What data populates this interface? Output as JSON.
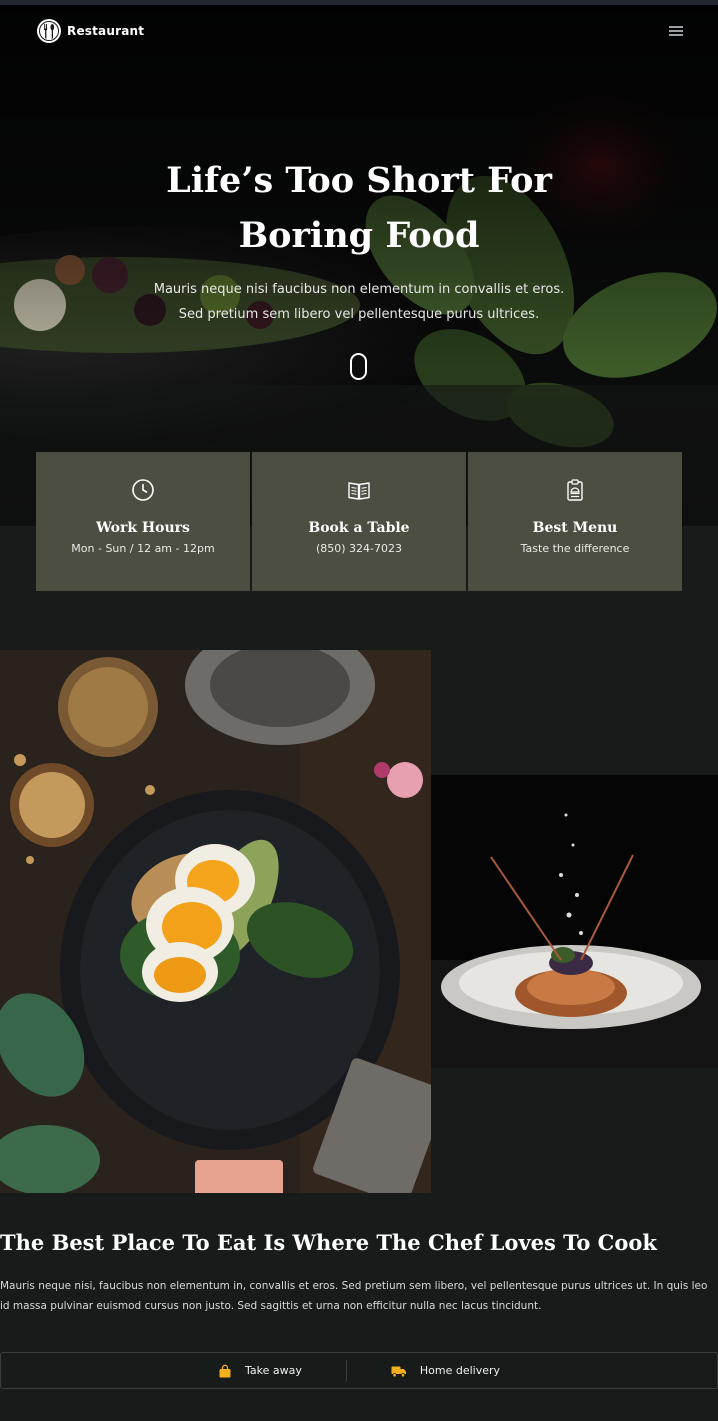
{
  "brand": {
    "name": "Restaurant",
    "logo_icon": "cutlery-icon"
  },
  "nav": {
    "menu_icon": "hamburger-menu-icon"
  },
  "hero": {
    "title_lines": [
      "Life’s Too Short For",
      "Boring Food"
    ],
    "subtitle_lines": [
      "Mauris neque nisi faucibus non elementum in convallis et eros.",
      "Sed pretium sem libero vel pellentesque purus ultrices."
    ],
    "scroll_icon": "mouse-scroll-icon"
  },
  "features": [
    {
      "icon": "clock-icon",
      "title": "Work Hours",
      "text": "Mon - Sun / 12 am - 12pm"
    },
    {
      "icon": "open-book-icon",
      "title": "Book a Table",
      "text": "(850) 324-7023"
    },
    {
      "icon": "menu-clipboard-icon",
      "title": "Best Menu",
      "text": "Taste the difference"
    }
  ],
  "about": {
    "title": "The Best Place To Eat Is Where The Chef Loves To Cook",
    "text_lines": [
      "Mauris neque nisi, faucibus non elementum in, convallis et eros. Sed pretium sem libero, vel pellentesque purus ultrices ut. In quis leo",
      "id massa pulvinar euismod cursus non justo. Sed sagittis et urna non efficitur nulla nec lacus tincidunt."
    ]
  },
  "services": [
    {
      "icon": "shopping-bag-icon",
      "label": "Take away"
    },
    {
      "icon": "delivery-truck-icon",
      "label": "Home delivery"
    }
  ],
  "colors": {
    "background": "#171b19",
    "feature_box": "#4b4e40",
    "accent": "#f2b01e"
  }
}
